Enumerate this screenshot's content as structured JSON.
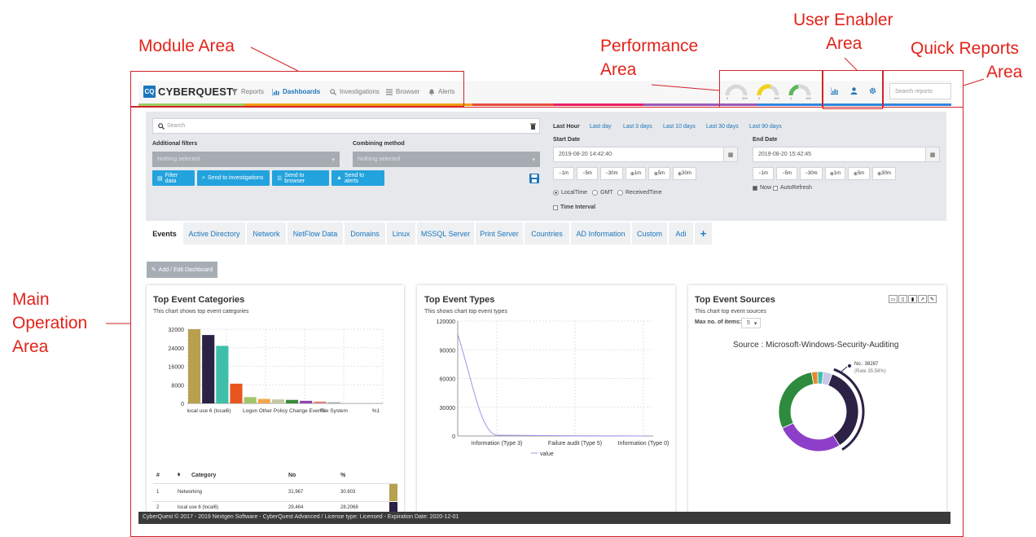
{
  "annotations": {
    "module_area": "Module Area",
    "performance_l1": "Performance",
    "performance_l2": "Area",
    "user_enabler_l1": "User Enabler",
    "user_enabler_l2": "Area",
    "quick_reports_l1": "Quick Reports",
    "quick_reports_l2": "Area",
    "main_op_l1": "Main",
    "main_op_l2": "Operation",
    "main_op_l3": "Area"
  },
  "header": {
    "logo_badge": "CQ",
    "logo_text": "CYBERQUEST",
    "nav": [
      {
        "label": "Reports",
        "icon": "filter-icon"
      },
      {
        "label": "Dashboards",
        "icon": "bar-chart-icon"
      },
      {
        "label": "Investigations",
        "icon": "search-icon"
      },
      {
        "label": "Browser",
        "icon": "list-icon"
      },
      {
        "label": "Alerts",
        "icon": "bell-icon"
      }
    ],
    "gauges": [
      {
        "min": "0",
        "max": "100",
        "color": "#cfcfcf",
        "level": 0
      },
      {
        "min": "0",
        "max": "100",
        "color": "#f2d21b",
        "level": 0.55
      },
      {
        "min": "0",
        "max": "100",
        "color": "#5cb85c",
        "level": 0.4
      }
    ],
    "search_reports_placeholder": "Search reports",
    "colors": {
      "accent": "#1c75bc"
    }
  },
  "filters": {
    "search_placeholder": "Search",
    "additional_filters_label": "Additional filters",
    "additional_filters_value": "Nothing selected",
    "combining_label": "Combining method",
    "combining_value": "Nothing selected",
    "buttons": [
      "Filter data",
      "Send to investigations",
      "Send to browser",
      "Send to alerts"
    ],
    "time_links": [
      "Last Hour",
      "Last day",
      "Last 3 days",
      "Last 10 days",
      "Last 30 days",
      "Last 90 days"
    ],
    "start_label": "Start Date",
    "start_value": "2019-08-20 14:42:40",
    "end_label": "End Date",
    "end_value": "2019-08-20 15:42:45",
    "adjust_buttons": [
      "1m",
      "5m",
      "30m",
      "1m",
      "5m",
      "30m"
    ],
    "timezones": [
      "LocalTime",
      "GMT",
      "ReceivedTime"
    ],
    "time_interval": "Time Interval",
    "now": "Now",
    "autorefresh": "AutoRefresh"
  },
  "tabs": [
    "Events",
    "Active Directory",
    "Network",
    "NetFlow Data",
    "Domains",
    "Linux",
    "MSSQL Server",
    "Print Server",
    "Countries",
    "AD Information",
    "Custom",
    "Adi",
    "+"
  ],
  "add_edit_dashboard": "Add / Edit Dashboard",
  "cards": {
    "categories": {
      "title": "Top Event Categories",
      "subtitle": "This chart shows top event categories",
      "table_headers": [
        "#",
        "Category",
        "No",
        "%"
      ],
      "rows": [
        {
          "n": "1",
          "category": "Networking",
          "no": "31,967",
          "pct": "30.603"
        },
        {
          "n": "2",
          "category": "local use 6 (local6)",
          "no": "29,464",
          "pct": "28.2068"
        }
      ]
    },
    "types": {
      "title": "Top Event Types",
      "subtitle": "This shows chart top event types",
      "legend": "value"
    },
    "sources": {
      "title": "Top Event Sources",
      "subtitle": "This chart top event sources",
      "max_items_label": "Max no. of items:",
      "max_items_value": "5",
      "chart_title": "Source : Microsoft-Windows-Security-Auditing",
      "callout_no": "No.: 38287",
      "callout_rate": "(Rate 35.58%)"
    }
  },
  "chart_data": [
    {
      "type": "bar",
      "title": "Top Event Categories",
      "categories": [
        "local use 6 (local6)",
        "",
        "",
        "",
        "Logon",
        "",
        "",
        "Other Policy Change Events",
        "",
        "",
        "File System",
        "",
        "",
        "%1"
      ],
      "values": [
        32000,
        29500,
        24800,
        8500,
        2700,
        1900,
        1700,
        1500,
        1100,
        800,
        500,
        300,
        150,
        80
      ],
      "colors": [
        "#b8a04e",
        "#2b2246",
        "#3dbfaa",
        "#e8561f",
        "#a4c46a",
        "#f3a54c",
        "#c8c8a0",
        "#3a8a3a",
        "#8e44ad",
        "#d98880",
        "#aaaaaa",
        "#dddddd",
        "#cccccc",
        "#eeeeee"
      ],
      "yticks": [
        "32000",
        "24000",
        "16000",
        "8000",
        "0"
      ],
      "ylim": [
        0,
        32000
      ],
      "xticks": [
        "local use 6 (local6)",
        "Logon",
        "Other Policy Change Events",
        "File System",
        "%1"
      ]
    },
    {
      "type": "line",
      "title": "Top Event Types",
      "x": [
        "Information (Type 3)",
        "Failure audit (Type 5)",
        "Information (Type 0)"
      ],
      "series": [
        {
          "name": "value",
          "values": [
            106000,
            800,
            10
          ]
        }
      ],
      "yticks": [
        "120000",
        "90000",
        "60000",
        "30000",
        "0"
      ],
      "ylim": [
        0,
        120000
      ]
    },
    {
      "type": "pie",
      "title": "Source : Microsoft-Windows-Security-Auditing",
      "slices": [
        {
          "value": 35.58,
          "color": "#2b2246"
        },
        {
          "value": 27,
          "color": "#8e3fc9"
        },
        {
          "value": 29,
          "color": "#2e8b3e"
        },
        {
          "value": 2.5,
          "color": "#e38b2f"
        },
        {
          "value": 2.3,
          "color": "#3dbfaa"
        },
        {
          "value": 3.6,
          "color": "#c9c6e6"
        }
      ]
    }
  ],
  "footer": "CyberQuest © 2017 - 2019 Nextgen Software - CyberQuest Advanced / License type: Licensed - Expiration Date: 2020-12-01"
}
